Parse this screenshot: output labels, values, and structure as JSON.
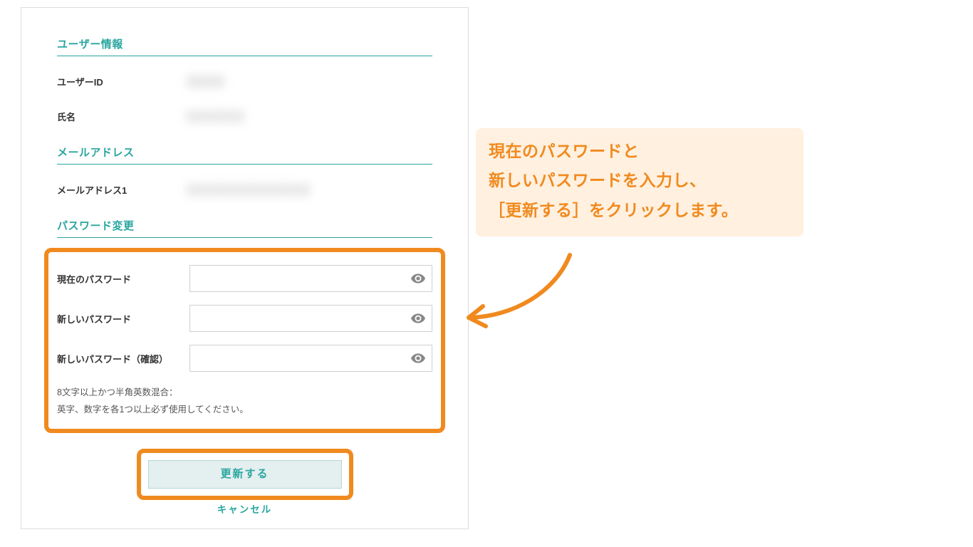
{
  "sections": {
    "user_info": {
      "heading": "ユーザー情報",
      "user_id_label": "ユーザーID",
      "user_id_value": "█████",
      "name_label": "氏名",
      "name_value": "███████"
    },
    "email": {
      "heading": "メールアドレス",
      "email1_label": "メールアドレス1",
      "email1_value": "███████████████"
    },
    "password": {
      "heading": "パスワード変更",
      "current_label": "現在のパスワード",
      "new_label": "新しいパスワード",
      "confirm_label": "新しいパスワード（確認）",
      "current_value": "",
      "new_value": "",
      "confirm_value": "",
      "hint_line1": "8文字以上かつ半角英数混合：",
      "hint_line2": "英字、数字を各1つ以上必ず使用してください。"
    }
  },
  "actions": {
    "update_label": "更新する",
    "cancel_label": "キャンセル"
  },
  "callout": {
    "line1": "現在のパスワードと",
    "line2": "新しいパスワードを入力し、",
    "line3": "［更新する］をクリックします。"
  },
  "colors": {
    "accent_teal": "#2aa6a0",
    "highlight_orange": "#f08a1f",
    "callout_bg": "#fff0df"
  }
}
